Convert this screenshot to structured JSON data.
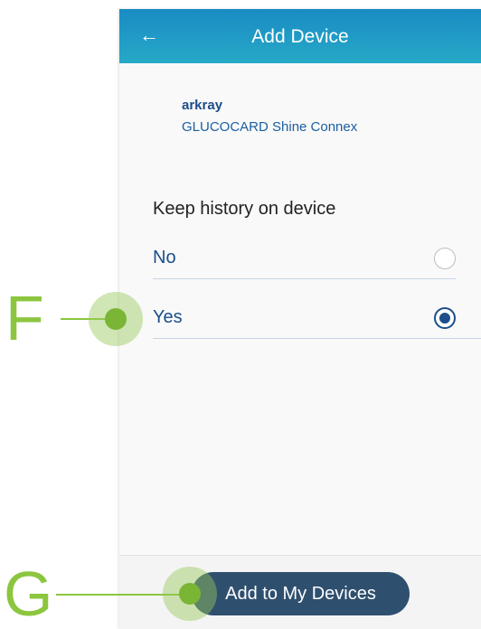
{
  "header": {
    "back_icon": "arrow-left-icon",
    "back_glyph": "←",
    "title": "Add Device"
  },
  "device": {
    "brand": "arkray",
    "model": "GLUCOCARD Shine Connex"
  },
  "history": {
    "title": "Keep history on device",
    "options": [
      {
        "label": "No",
        "selected": false
      },
      {
        "label": "Yes",
        "selected": true
      }
    ]
  },
  "footer": {
    "add_button": "Add to My Devices"
  },
  "annotations": {
    "f": "F",
    "g": "G"
  },
  "colors": {
    "header_gradient_start": "#1a8bc4",
    "header_gradient_end": "#26a9c7",
    "primary_text": "#1b4e8a",
    "button_bg": "#2f4f6f",
    "annotation_green": "#8cc63f"
  }
}
